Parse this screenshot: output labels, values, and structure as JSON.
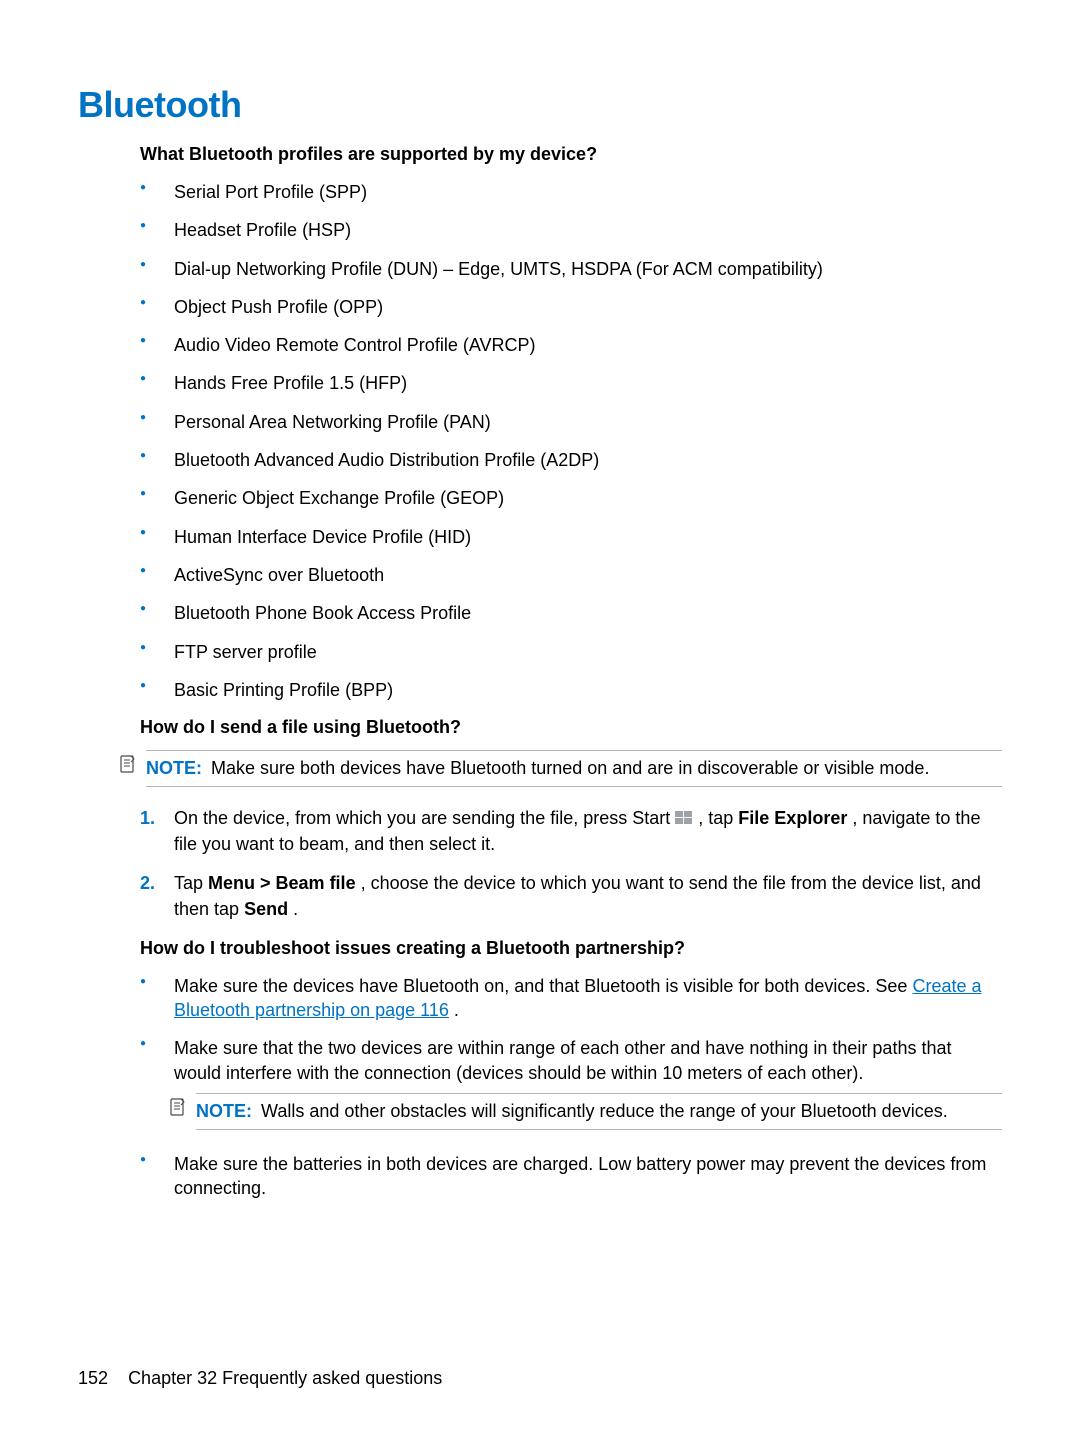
{
  "title": "Bluetooth",
  "q1": {
    "heading": "What Bluetooth profiles are supported by my device?",
    "items": [
      "Serial Port Profile (SPP)",
      "Headset Profile (HSP)",
      "Dial-up Networking Profile (DUN) – Edge, UMTS, HSDPA (For ACM compatibility)",
      "Object Push Profile (OPP)",
      "Audio Video Remote Control Profile (AVRCP)",
      "Hands Free Profile 1.5 (HFP)",
      "Personal Area Networking Profile (PAN)",
      "Bluetooth Advanced Audio Distribution Profile (A2DP)",
      "Generic Object Exchange Profile (GEOP)",
      "Human Interface Device Profile (HID)",
      "ActiveSync over Bluetooth",
      "Bluetooth Phone Book Access Profile",
      "FTP server profile",
      "Basic Printing Profile (BPP)"
    ]
  },
  "q2": {
    "heading": "How do I send a file using Bluetooth?",
    "note_label": "NOTE:",
    "note_text": "Make sure both devices have Bluetooth turned on and are in discoverable or visible mode.",
    "step1_a": "On the device, from which you are sending the file, press Start ",
    "step1_b": ", tap ",
    "step1_c": "File Explorer",
    "step1_d": ", navigate to the file you want to beam, and then select it.",
    "step2_a": "Tap ",
    "step2_b": "Menu > Beam file",
    "step2_c": ", choose the device to which you want to send the file from the device list, and then tap ",
    "step2_d": "Send",
    "step2_e": "."
  },
  "q3": {
    "heading": "How do I troubleshoot issues creating a Bluetooth partnership?",
    "b1_a": "Make sure the devices have Bluetooth on, and that Bluetooth is visible for both devices. See ",
    "b1_link": "Create a Bluetooth partnership on page 116",
    "b1_c": ".",
    "b2": "Make sure that the two devices are within range of each other and have nothing in their paths that would interfere with the connection (devices should be within 10 meters of each other).",
    "note2_label": "NOTE:",
    "note2_text": "Walls and other obstacles will significantly reduce the range of your Bluetooth devices.",
    "b3": "Make sure the batteries in both devices are charged. Low battery power may prevent the devices from connecting."
  },
  "footer": {
    "page": "152",
    "chapter": "Chapter 32   Frequently asked questions"
  }
}
